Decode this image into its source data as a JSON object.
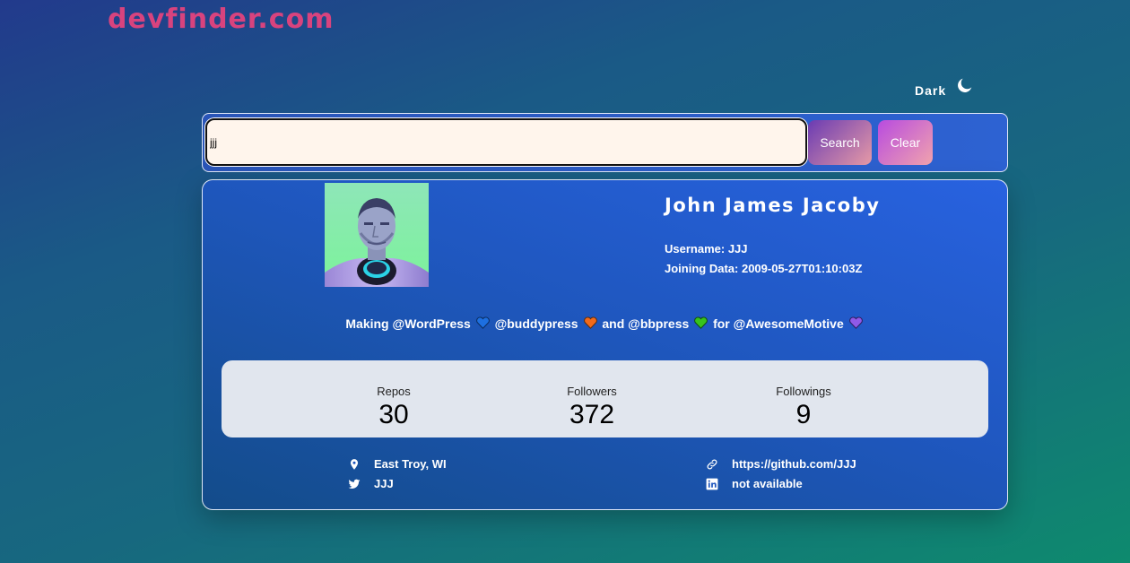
{
  "app": {
    "logo": "devfinder.com"
  },
  "theme": {
    "label": "Dark",
    "icon": "moon-icon"
  },
  "search": {
    "value": "jjj",
    "search_label": "Search",
    "clear_label": "Clear"
  },
  "profile": {
    "name": "John James Jacoby",
    "username_label": "Username:",
    "username": "JJJ",
    "joined_label": "Joining Data:",
    "joined": "2009-05-27T01:10:03Z",
    "bio": {
      "part1": "Making @WordPress",
      "part2": "@buddypress",
      "part3": "and @bbpress",
      "part4": "for @AwesomeMotive",
      "heart_colors": [
        "#1d6fe0",
        "#f26a1b",
        "#37c21c",
        "#8f5ae8"
      ]
    }
  },
  "stats": [
    {
      "label": "Repos",
      "value": "30"
    },
    {
      "label": "Followers",
      "value": "372"
    },
    {
      "label": "Followings",
      "value": "9"
    }
  ],
  "links": {
    "location": "East Troy, WI",
    "twitter": "JJJ",
    "website": "https://github.com/JJJ",
    "linkedin": "not available"
  },
  "colors": {
    "logo": "#d8437e",
    "stats_bg": "#e1e6ee",
    "input_bg": "#fff5ec"
  }
}
